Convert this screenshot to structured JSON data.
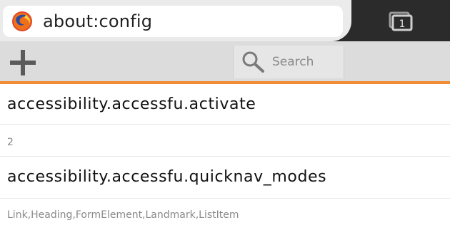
{
  "urlbar": {
    "url": "about:config",
    "tabs_count": "1",
    "favicon_icon": "firefox-icon"
  },
  "toolbar": {
    "add_icon": "plus-icon",
    "search_placeholder": "Search",
    "search_icon": "search-icon"
  },
  "prefs": [
    {
      "name": "accessibility.accessfu.activate",
      "value": "2"
    },
    {
      "name": "accessibility.accessfu.quicknav_modes",
      "value": "Link,Heading,FormElement,Landmark,ListItem"
    }
  ],
  "colors": {
    "accent": "#f08a33",
    "dark_tabstrip": "#2b2b2b"
  }
}
